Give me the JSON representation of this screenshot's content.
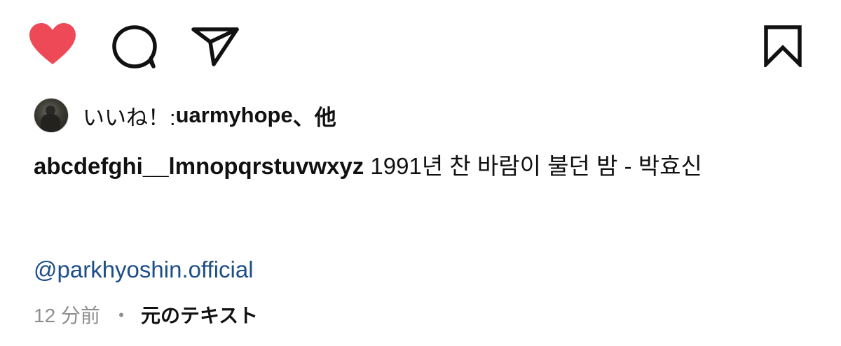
{
  "actions": {
    "like_icon": "heart-filled",
    "comment_icon": "comment-bubble",
    "share_icon": "paper-plane",
    "save_icon": "bookmark-outline",
    "like_color": "#ed4956",
    "icon_stroke_color": "#111111"
  },
  "likes": {
    "prefix": "いいね！: ",
    "username": "uarmyhope",
    "suffix": "、他"
  },
  "caption": {
    "username": "abcdefghi__lmnopqrstuvwxyz",
    "text": " 1991년 찬 바람이 불던 밤 - 박효신"
  },
  "mention": {
    "text": "@parkhyoshin.official",
    "color": "#1d4e89"
  },
  "meta": {
    "timestamp": "12 分前",
    "separator": "・",
    "see_original": "元のテキスト"
  }
}
